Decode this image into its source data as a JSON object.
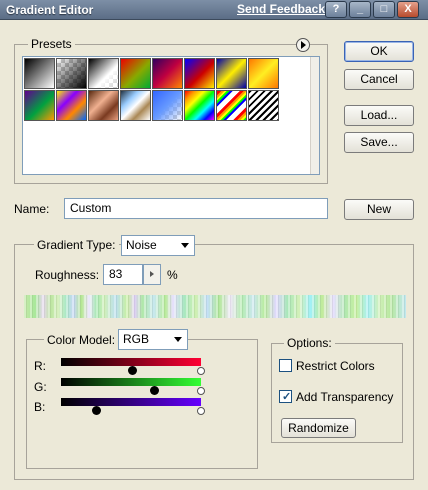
{
  "window": {
    "title": "Gradient Editor",
    "feedback_link": "Send Feedback",
    "controls": {
      "help": "?",
      "minimize": "_",
      "maximize": "□",
      "close": "X"
    }
  },
  "presets": {
    "label": "Presets",
    "menu_icon": "menu-arrow-icon",
    "swatches": [
      "black-white",
      "transparent-black",
      "black-white-transparent",
      "red-green",
      "violet-orange",
      "blue-red-yellow",
      "blue-yellow-blue",
      "orange-yellow-orange",
      "violet-green-orange",
      "yellow-violet-orange-blue",
      "copper",
      "chrome",
      "transparent-blue",
      "spectrum",
      "transparent-rainbow",
      "transparent-stripes"
    ]
  },
  "buttons": {
    "ok": "OK",
    "cancel": "Cancel",
    "load": "Load...",
    "save": "Save...",
    "new": "New",
    "randomize": "Randomize"
  },
  "name": {
    "label": "Name:",
    "value": "Custom"
  },
  "gradient": {
    "type_label": "Gradient Type:",
    "type_value": "Noise",
    "roughness_label": "Roughness:",
    "roughness_value": "83",
    "roughness_unit": "%"
  },
  "color_model": {
    "label": "Color Model:",
    "value": "RGB",
    "channels": [
      {
        "label": "R:",
        "from": "#000000",
        "to": "#ff0033",
        "low": 0.0,
        "high": 1.0,
        "mid_pos": 0.52
      },
      {
        "label": "G:",
        "from": "#000000",
        "to": "#33ff33",
        "low": 0.0,
        "high": 1.0,
        "mid_pos": 0.67
      },
      {
        "label": "B:",
        "from": "#000000",
        "to": "#6600ff",
        "low": 0.0,
        "high": 1.0,
        "mid_pos": 0.25
      }
    ]
  },
  "options": {
    "label": "Options:",
    "restrict_colors": {
      "label": "Restrict Colors",
      "checked": false
    },
    "add_transparency": {
      "label": "Add Transparency",
      "checked": true
    }
  }
}
